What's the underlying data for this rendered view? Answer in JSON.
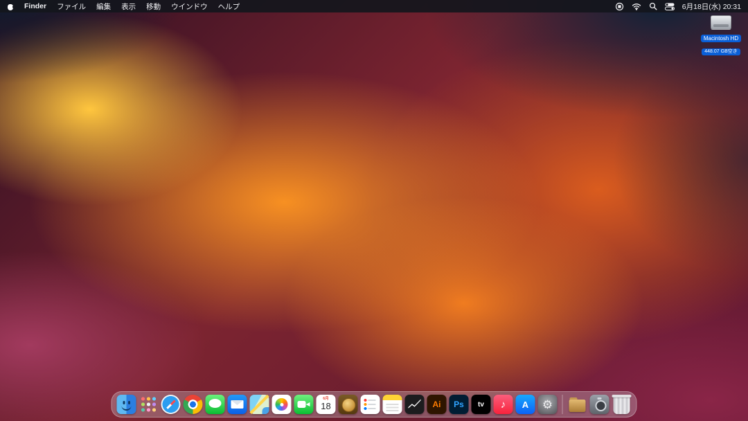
{
  "menu_bar": {
    "app_name": "Finder",
    "menus": [
      "ファイル",
      "編集",
      "表示",
      "移動",
      "ウインドウ",
      "ヘルプ"
    ],
    "clock": "6月18日(水) 20:31",
    "status_icons": [
      "screen-recording-stop",
      "wifi",
      "spotlight",
      "control-center"
    ]
  },
  "desktop": {
    "volume": {
      "name": "Macintosh HD",
      "info": "448.07 GB空き"
    }
  },
  "dock": {
    "items": [
      {
        "id": "finder",
        "name": "Finder"
      },
      {
        "id": "launchpad",
        "name": "Launchpad"
      },
      {
        "id": "safari",
        "name": "Safari"
      },
      {
        "id": "chrome",
        "name": "Google Chrome"
      },
      {
        "id": "messages",
        "name": "メッセージ"
      },
      {
        "id": "mail",
        "name": "メール"
      },
      {
        "id": "maps",
        "name": "マップ"
      },
      {
        "id": "photos",
        "name": "写真"
      },
      {
        "id": "facetime",
        "name": "FaceTime"
      },
      {
        "id": "calendar",
        "name": "カレンダー",
        "glyph": "6月",
        "glyph2": "18"
      },
      {
        "id": "coin",
        "name": "coin-app"
      },
      {
        "id": "reminders",
        "name": "リマインダー"
      },
      {
        "id": "notes",
        "name": "メモ"
      },
      {
        "id": "stocks",
        "name": "株価"
      },
      {
        "id": "illustrator",
        "name": "Adobe Illustrator",
        "glyph": "Ai"
      },
      {
        "id": "photoshop",
        "name": "Adobe Photoshop",
        "glyph": "Ps"
      },
      {
        "id": "tv",
        "name": "TV",
        "glyph": "tv"
      },
      {
        "id": "music",
        "name": "ミュージック",
        "glyph": "♪"
      },
      {
        "id": "appstore",
        "name": "App Store",
        "glyph": "A"
      },
      {
        "id": "settings",
        "name": "システム設定",
        "glyph": "⚙"
      },
      {
        "id": "separator"
      },
      {
        "id": "downloads",
        "name": "ダウンロード"
      },
      {
        "id": "camera",
        "name": "スクリーンショット"
      },
      {
        "id": "trash",
        "name": "ゴミ箱"
      }
    ]
  }
}
